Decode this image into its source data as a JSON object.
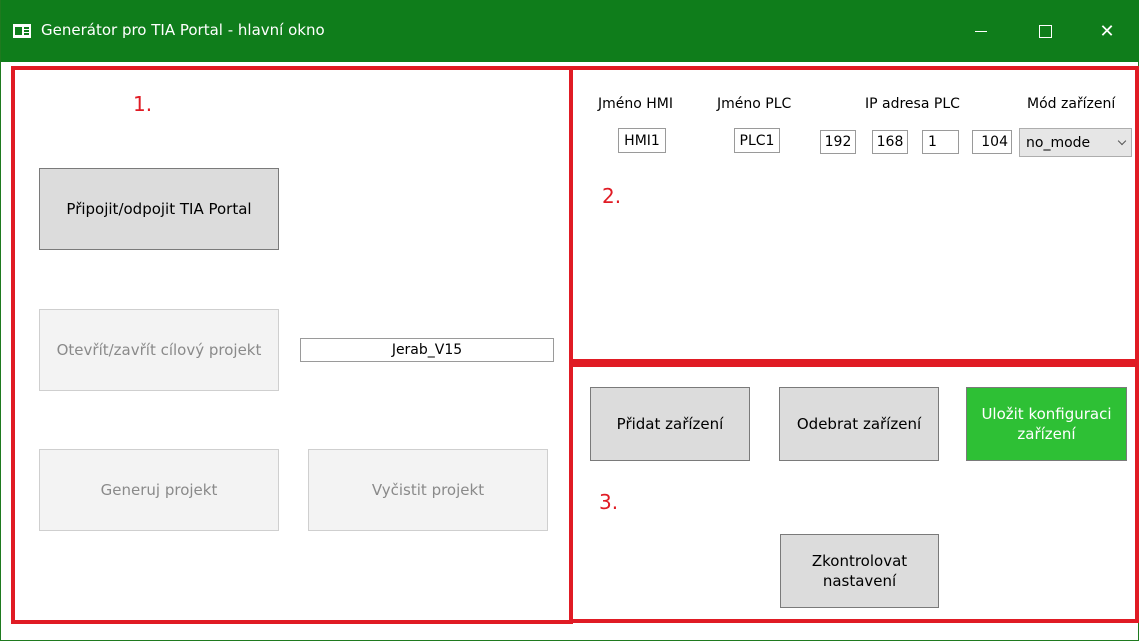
{
  "window": {
    "title": "Generátor pro TIA Portal - hlavní okno",
    "controls": {
      "minimize": "minimize-icon",
      "maximize": "maximize-icon",
      "close": "✕"
    }
  },
  "panel1": {
    "number": "1.",
    "connect_button": "Připojit/odpojit TIA Portal",
    "open_project_button": "Otevřít/zavřít cílový projekt",
    "project_name": "Jerab_V15",
    "generate_button": "Generuj projekt",
    "clean_button": "Vyčistit projekt"
  },
  "panel2": {
    "number": "2.",
    "headers": {
      "hmi_name": "Jméno HMI",
      "plc_name": "Jméno PLC",
      "plc_ip": "IP adresa PLC",
      "device_mode": "Mód zařízení"
    },
    "row": {
      "hmi_name": "HMI1",
      "plc_name": "PLC1",
      "ip": [
        "192",
        "168",
        "1",
        "104"
      ],
      "mode": "no_mode"
    }
  },
  "panel3": {
    "number": "3.",
    "add_button": "Přidat zařízení",
    "remove_button": "Odebrat zařízení",
    "save_button": "Uložit konfiguraci zařízení",
    "check_button": "Zkontrolovat nastavení"
  },
  "colors": {
    "titlebar": "#0f7d1b",
    "panel_border": "#e01b24",
    "save_green": "#2ec035"
  }
}
